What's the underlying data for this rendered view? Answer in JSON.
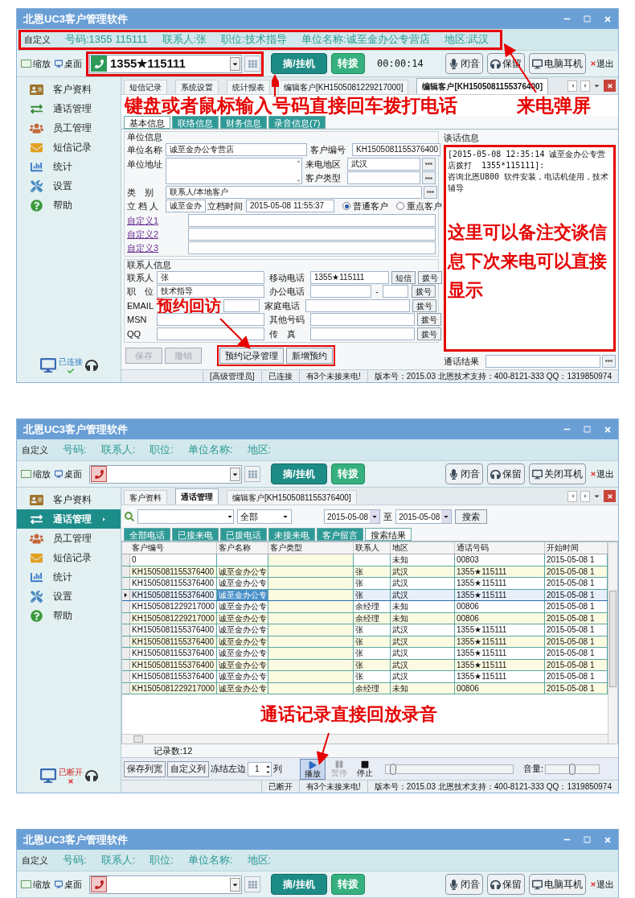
{
  "windows": [
    {
      "title": "北恩UC3客户管理软件",
      "info_bar": {
        "label": "自定义",
        "fields": [
          "号码:1355 115111",
          "联系人:张",
          "职位:技术指导",
          "单位名称:诚至金办公专营店",
          "地区:武汉"
        ],
        "highlighted": true
      },
      "toolbar": {
        "zoom": "缩放",
        "desktop": "桌面",
        "phone": {
          "active": true,
          "number": "1355★115111",
          "highlighted": true
        },
        "hook": "摘/挂机",
        "transfer": "转拨",
        "timer": "00:00:14",
        "buttons": [
          "闭音",
          "保留",
          "电脑耳机"
        ],
        "exit": "退出"
      },
      "sidebar": {
        "items": [
          {
            "label": "客户资料",
            "selected": false
          },
          {
            "label": "通话管理",
            "selected": false
          },
          {
            "label": "员工管理",
            "selected": false
          },
          {
            "label": "短信记录",
            "selected": false
          },
          {
            "label": "统计",
            "selected": false
          },
          {
            "label": "设置",
            "selected": false
          },
          {
            "label": "帮助",
            "selected": false
          }
        ],
        "connection": {
          "label": "已连接",
          "connected": true
        }
      },
      "body": {
        "kind": "customer_form",
        "tabs": [
          {
            "label": "短信记录",
            "selected": false
          },
          {
            "label": "系统设置",
            "selected": false
          },
          {
            "label": "统计报表",
            "selected": false
          },
          {
            "label": "编辑客户[KH1505081229217000]",
            "selected": false
          },
          {
            "label": "编辑客户[KH1505081155376400]",
            "selected": true
          }
        ],
        "dial_hint": "键盘或者鼠标输入号码直接回车拨打电话",
        "popup_hint": "来电弹屏",
        "subtabs": [
          {
            "label": "基本信息",
            "selected": true
          },
          {
            "label": "联络信息",
            "selected": false
          },
          {
            "label": "财务信息",
            "selected": false
          },
          {
            "label": "录音信息(7)",
            "selected": false
          }
        ],
        "company_group": "单位信息",
        "company_name_label": "单位名称",
        "company_name": "诚至金办公专营店",
        "customer_no_label": "客户编号",
        "customer_no": "KH1505081155376400",
        "address_label": "单位地址",
        "region_label": "来电地区",
        "region": "武汉",
        "type_label": "客户类型",
        "category_label": "类　别",
        "category": "联系人/本地客户",
        "creator_label": "立 档 人",
        "creator": "诚至金办",
        "created_label": "立档时间",
        "created": "2015-05-08 11:55:37",
        "priority": [
          {
            "label": "普通客户",
            "selected": true
          },
          {
            "label": "重点客户",
            "selected": false
          }
        ],
        "custom_fields": [
          "自定义1",
          "自定义2",
          "自定义3"
        ],
        "contact_group": "联系人信息",
        "contact_rows": [
          {
            "kind": "sms",
            "label": "联系人",
            "value": "张",
            "phone_label": "移动电话",
            "phone": "1355★115111",
            "sms": "短信",
            "dial": "拨号"
          },
          {
            "kind": "ext",
            "label": "职　位",
            "value": "技术指导",
            "phone_label": "办公电话",
            "separator": "-",
            "dial": "拨号"
          },
          {
            "kind": "plain",
            "label": "EMAIL",
            "callout": "预约回访",
            "phone_label": "家庭电话",
            "dial": "拨号"
          },
          {
            "kind": "plain",
            "label": "MSN",
            "phone_label": "其他号码",
            "dial": "拨号"
          },
          {
            "kind": "plain",
            "label": "QQ",
            "phone_label": "传　真",
            "dial": "拨号"
          }
        ],
        "buttons": [
          {
            "label": "保存",
            "disabled": true
          },
          {
            "label": "撤销",
            "disabled": true
          }
        ],
        "appointment_buttons": [
          "预约记录管理",
          "新增预约"
        ],
        "appointment_highlighted": true,
        "memo_label": "谈话信息",
        "memo": "[2015-05-08 12:35:14 诚至金办公专营店拨打  1355*115111]:\n咨询北恩U800 软件安装，电话机使用，技术辅导",
        "memo_highlighted": true,
        "memo_hint": "这里可以备注交谈信息下次来电可以直接显示",
        "result_label": "通话结果",
        "status": [
          "[高级管理员]",
          "已连接",
          "有3个未接来电!",
          "版本号：2015.03 北恩技术支持：400-8121-333 QQ：1319850974"
        ]
      }
    },
    {
      "title": "北恩UC3客户管理软件",
      "info_bar": {
        "label": "自定义",
        "fields": [
          "号码:",
          "联系人:",
          "职位:",
          "单位名称:",
          "地区:"
        ],
        "highlighted": false
      },
      "toolbar": {
        "zoom": "缩放",
        "desktop": "桌面",
        "phone": {
          "active": false,
          "highlighted": false
        },
        "hook": "摘/挂机",
        "transfer": "转拨",
        "buttons": [
          "闭音",
          "保留",
          "关闭耳机"
        ],
        "exit": "退出"
      },
      "sidebar": {
        "items": [
          {
            "label": "客户资料",
            "selected": false
          },
          {
            "label": "通话管理",
            "selected": true
          },
          {
            "label": "员工管理",
            "selected": false
          },
          {
            "label": "短信记录",
            "selected": false
          },
          {
            "label": "统计",
            "selected": false
          },
          {
            "label": "设置",
            "selected": false
          },
          {
            "label": "帮助",
            "selected": false
          }
        ],
        "connection": {
          "label": "已断开",
          "connected": false
        }
      },
      "body": {
        "kind": "call_log",
        "tabs": [
          {
            "label": "客户资料",
            "selected": false
          },
          {
            "label": "通话管理",
            "selected": true
          },
          {
            "label": "编辑客户[KH1505081155376400]",
            "selected": false
          }
        ],
        "search": {
          "filter": "全部",
          "from": "2015-05-08",
          "to_label": "至",
          "to": "2015-05-08",
          "button": "搜索"
        },
        "subtabs": [
          {
            "label": "全部电话",
            "selected": false
          },
          {
            "label": "已接来电",
            "selected": false
          },
          {
            "label": "已拨电话",
            "selected": false
          },
          {
            "label": "未接来电",
            "selected": false
          },
          {
            "label": "客户留言",
            "selected": false
          },
          {
            "label": "搜索结果",
            "selected": true
          }
        ],
        "table": {
          "columns": [
            "客户编号",
            "客户名称",
            "客户类型",
            "联系人",
            "地区",
            "通话号码",
            "开始时间"
          ],
          "rows": [
            {
              "cells": [
                "0",
                null,
                null,
                null,
                "未知",
                "00803",
                "2015-05-08 1"
              ],
              "selected": false
            },
            {
              "cells": [
                "KH1505081155376400",
                "诚至金办公专",
                null,
                "张",
                "武汉",
                "1355★115111",
                "2015-05-08 1"
              ],
              "selected": false
            },
            {
              "cells": [
                "KH1505081155376400",
                "诚至金办公专",
                null,
                "张",
                "武汉",
                "1355★115111",
                "2015-05-08 1"
              ],
              "selected": false
            },
            {
              "cells": [
                "KH1505081155376400",
                "诚至金办公专",
                null,
                "张",
                "武汉",
                "1355★115111",
                "2015-05-08 1"
              ],
              "selected": true
            },
            {
              "cells": [
                "KH1505081229217000",
                "诚至金办公专",
                null,
                "余经理",
                "未知",
                "00806",
                "2015-05-08 1"
              ],
              "selected": false
            },
            {
              "cells": [
                "KH1505081229217000",
                "诚至金办公专",
                null,
                "余经理",
                "未知",
                "00806",
                "2015-05-08 1"
              ],
              "selected": false
            },
            {
              "cells": [
                "KH1505081155376400",
                "诚至金办公专",
                null,
                "张",
                "武汉",
                "1355★115111",
                "2015-05-08 1"
              ],
              "selected": false
            },
            {
              "cells": [
                "KH1505081155376400",
                "诚至金办公专",
                null,
                "张",
                "武汉",
                "1355★115111",
                "2015-05-08 1"
              ],
              "selected": false
            },
            {
              "cells": [
                "KH1505081155376400",
                "诚至金办公专",
                null,
                "张",
                "武汉",
                "1355★115111",
                "2015-05-08 1"
              ],
              "selected": false
            },
            {
              "cells": [
                "KH1505081155376400",
                "诚至金办公专",
                null,
                "张",
                "武汉",
                "1355★115111",
                "2015-05-08 1"
              ],
              "selected": false
            },
            {
              "cells": [
                "KH1505081155376400",
                "诚至金办公专",
                null,
                "张",
                "武汉",
                "1355★115111",
                "2015-05-08 1"
              ],
              "selected": false
            },
            {
              "cells": [
                "KH1505081229217000",
                "诚至金办公专",
                null,
                "余经理",
                "未知",
                "00806",
                "2015-05-08 1"
              ],
              "selected": false
            }
          ]
        },
        "playback_hint": "通话记录直接回放录音",
        "record_count": "记录数:12",
        "footer": {
          "save_widths": "保存列宽",
          "custom_columns": "自定义列",
          "freeze_label": "冻结左边",
          "freeze_value": "1",
          "freeze_unit": "列",
          "play": {
            "label": "播放",
            "active": true
          },
          "pause": {
            "label": "暂停",
            "disabled": true
          },
          "stop": {
            "label": "停止"
          },
          "progress": {
            "level": 0.06
          },
          "volume_label": "音量:",
          "volume": {
            "level": 0.5
          }
        },
        "status": [
          "已断开",
          "有3个未接来电!",
          "版本号：2015.03 北恩技术支持：400-8121-333 QQ：1319850974"
        ]
      }
    },
    {
      "title": "北恩UC3客户管理软件",
      "info_bar": {
        "label": "自定义",
        "fields": [
          "号码:",
          "联系人:",
          "职位:",
          "单位名称:",
          "地区:"
        ],
        "highlighted": false
      },
      "toolbar": {
        "zoom": "缩放",
        "desktop": "桌面",
        "phone": {
          "active": false,
          "highlighted": false
        },
        "hook": "摘/挂机",
        "transfer": "转拨",
        "buttons": [
          "闭音",
          "保留",
          "电脑耳机"
        ],
        "exit": "退出"
      },
      "body": {
        "kind": "cut"
      }
    }
  ]
}
